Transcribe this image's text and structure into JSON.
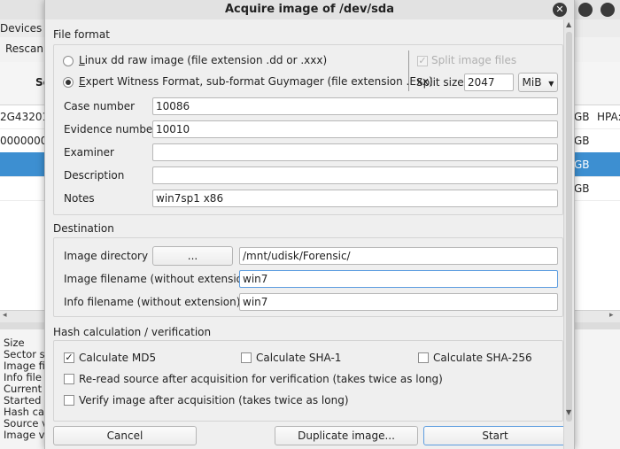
{
  "background": {
    "menu_devices": "Devices",
    "toolbar_rescan": "Rescan",
    "col_serial_fragment": "Se",
    "rows": [
      {
        "serial": "2G43201",
        "size_unit": "GB",
        "hpa": "HPA:"
      },
      {
        "serial": "00000000",
        "size_unit": "GB",
        "hpa": ""
      },
      {
        "serial": "",
        "size_unit": "GB",
        "hpa": ""
      },
      {
        "serial": "",
        "size_unit": "GB",
        "hpa": ""
      }
    ],
    "info_labels": [
      "Size",
      "Sector si",
      "Image fil",
      "Info file",
      "Current s",
      "Started",
      "Hash cal",
      "Source v",
      "Image ve"
    ]
  },
  "dialog": {
    "title": "Acquire image of /dev/sda",
    "file_format": {
      "section": "File format",
      "option_linux_dd": "Linux dd raw image (file extension .dd or .xxx)",
      "option_linux_dd_mnemonic": "L",
      "option_ewf": "Expert Witness Format, sub-format Guymager (file extension .Exx)",
      "option_ewf_mnemonic": "E",
      "selected": "ewf",
      "split_image_files_label": "Split image files",
      "split_image_files_checked": true,
      "split_size_label": "Split size",
      "split_size_value": "2047",
      "split_unit": "MiB",
      "fields": [
        {
          "label": "Case number",
          "value": "10086"
        },
        {
          "label": "Evidence number",
          "value": "10010"
        },
        {
          "label": "Examiner",
          "value": ""
        },
        {
          "label": "Description",
          "value": ""
        },
        {
          "label": "Notes",
          "value": "win7sp1 x86"
        }
      ]
    },
    "destination": {
      "section": "Destination",
      "image_directory_label": "Image directory",
      "browse_label": "...",
      "image_directory_value": "/mnt/udisk/Forensic/",
      "image_filename_label": "Image filename (without extension)",
      "image_filename_value": "win7",
      "info_filename_label": "Info filename (without extension)",
      "info_filename_value": "win7"
    },
    "hash": {
      "section": "Hash calculation / verification",
      "md5_label": "Calculate MD5",
      "md5_checked": true,
      "sha1_label": "Calculate SHA-1",
      "sha1_checked": false,
      "sha256_label": "Calculate SHA-256",
      "sha256_checked": false,
      "reread_label": "Re-read source after acquisition for verification (takes twice as long)",
      "reread_checked": false,
      "verify_label": "Verify image after acquisition (takes twice as long)",
      "verify_checked": false
    },
    "buttons": {
      "cancel": "Cancel",
      "duplicate": "Duplicate image...",
      "start": "Start"
    },
    "icons": {
      "close": "close-icon",
      "dropdown": "chevron-down-icon",
      "checkmark": "checkmark-icon"
    }
  }
}
